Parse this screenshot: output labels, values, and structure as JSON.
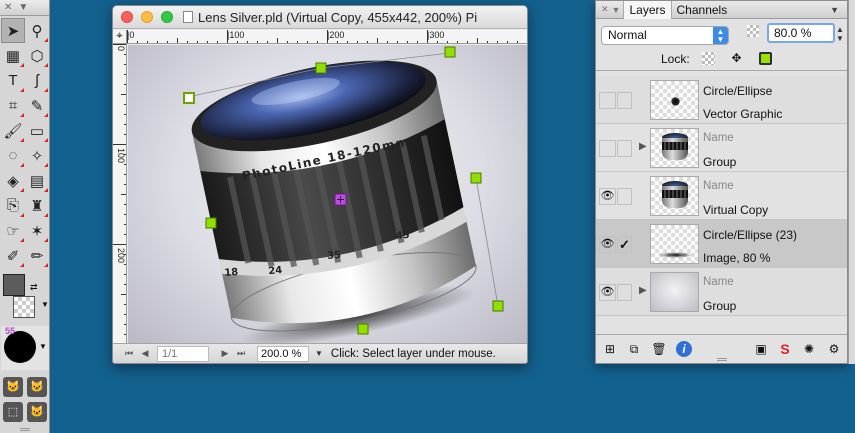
{
  "document": {
    "title": "Lens Silver.pld (Virtual Copy, 455x442, 200%) Pi",
    "ruler_h_labels": [
      "|0",
      "|100",
      "|200",
      "|300"
    ],
    "ruler_v_labels": [
      "0",
      "100",
      "200"
    ],
    "page_value": "1/1",
    "zoom_value": "200.0 %",
    "status_text": "Click: Select layer under mouse.",
    "lens_text": "PhotoLine 18-120mm",
    "lens_scale": [
      "18",
      "24",
      "35",
      "45"
    ]
  },
  "tools": {
    "brush_size": "55",
    "items": [
      {
        "name": "select-arrow-icon",
        "glyph": "➤"
      },
      {
        "name": "zoom-icon",
        "glyph": "⚲"
      },
      {
        "name": "transform-icon",
        "glyph": "▦"
      },
      {
        "name": "shape-icon",
        "glyph": "⬡"
      },
      {
        "name": "text-icon",
        "glyph": "T"
      },
      {
        "name": "path-icon",
        "glyph": "ʃ"
      },
      {
        "name": "crop-icon",
        "glyph": "⌗"
      },
      {
        "name": "eyedropper-icon",
        "glyph": "✎"
      },
      {
        "name": "brush-icon",
        "glyph": "🖌"
      },
      {
        "name": "eraser-icon",
        "glyph": "▭"
      },
      {
        "name": "lasso-icon",
        "glyph": "◌"
      },
      {
        "name": "magic-wand-icon",
        "glyph": "✧"
      },
      {
        "name": "fill-icon",
        "glyph": "◈"
      },
      {
        "name": "gradient-icon",
        "glyph": "▤"
      },
      {
        "name": "clone-icon",
        "glyph": "⎘"
      },
      {
        "name": "stamp-icon",
        "glyph": "♜"
      },
      {
        "name": "smudge-icon",
        "glyph": "☞"
      },
      {
        "name": "retouch-icon",
        "glyph": "✶"
      },
      {
        "name": "dodge-icon",
        "glyph": "✐"
      },
      {
        "name": "pencil-icon",
        "glyph": "✏"
      }
    ],
    "bottom_items": [
      {
        "name": "mask-icon",
        "glyph": "🐱"
      },
      {
        "name": "mask-add-icon",
        "glyph": "🐱"
      },
      {
        "name": "selection-icon",
        "glyph": "⬚"
      },
      {
        "name": "mask-plus-icon",
        "glyph": "🐱"
      }
    ]
  },
  "layers_panel": {
    "tabs": [
      "Layers",
      "Channels"
    ],
    "blend_mode": "Normal",
    "opacity": "80.0 %",
    "lock_label": "Lock:",
    "layers": [
      {
        "name": "Circle/Ellipse",
        "type": "Vector Graphic",
        "visible": false,
        "selected": false,
        "thumb": "dot",
        "name_placeholder": false
      },
      {
        "name": "Name",
        "type": "Group",
        "visible": false,
        "selected": false,
        "thumb": "lens",
        "name_placeholder": true,
        "expandable": true
      },
      {
        "name": "Name",
        "type": "Virtual Copy",
        "visible": true,
        "selected": false,
        "thumb": "lens",
        "name_placeholder": true
      },
      {
        "name": "Circle/Ellipse (23)",
        "type": "Image, 80 %",
        "visible": true,
        "selected": true,
        "locked": true,
        "thumb": "shadow",
        "name_placeholder": false
      },
      {
        "name": "Name",
        "type": "Group",
        "visible": true,
        "selected": false,
        "thumb": "gradient",
        "name_placeholder": true,
        "expandable": true
      }
    ]
  },
  "colors": {
    "desktop": "#13618f",
    "handle": "#8fe000",
    "center_handle": "#c04ae8",
    "accent_blue": "#3b8de8"
  }
}
